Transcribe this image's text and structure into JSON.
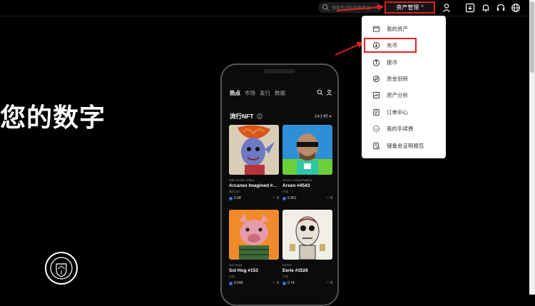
{
  "topbar": {
    "search_placeholder": "搜索币对和其他产品",
    "asset_button_label": "资产管理",
    "asset_button_chevron": "^"
  },
  "hero": {
    "text": "您的数字"
  },
  "badge": {
    "icon": "manchester-city-badge"
  },
  "phone": {
    "tabs": [
      "热点",
      "市场",
      "发行",
      "数据"
    ],
    "section_title": "流行NFT",
    "time_filter": "24小时 ▾",
    "cards": [
      {
        "collection": "40k Arcane Valley",
        "name": "Arcanes Imagined #...",
        "sub": "最低出价",
        "price": "0.98",
        "likes": "0"
      },
      {
        "collection": "Clever Ariana Nation",
        "name": "Arsen #4543",
        "sub": "价格",
        "price": "5.961",
        "likes": "0"
      },
      {
        "collection": "Sol Hogs",
        "name": "Sol Hog #153",
        "sub": "价格",
        "price": "0.049",
        "likes": "0"
      },
      {
        "collection": "Eeries",
        "name": "Eerie #1526",
        "sub": "价格",
        "price": "0.74",
        "likes": "0"
      }
    ]
  },
  "menu": {
    "items": [
      {
        "label": "我的资产",
        "icon": "wallet-icon"
      },
      {
        "label": "充币",
        "icon": "deposit-icon"
      },
      {
        "label": "提币",
        "icon": "withdraw-icon"
      },
      {
        "label": "资金划转",
        "icon": "transfer-icon"
      },
      {
        "label": "资产分析",
        "icon": "analysis-icon"
      },
      {
        "label": "订单中心",
        "icon": "order-icon"
      },
      {
        "label": "我的手续费",
        "icon": "fee-icon"
      },
      {
        "label": "储备金证明报告",
        "icon": "reserve-report-icon"
      }
    ]
  },
  "colors": {
    "highlight": "#e02020",
    "background": "#000000",
    "menu_bg": "#ffffff"
  }
}
